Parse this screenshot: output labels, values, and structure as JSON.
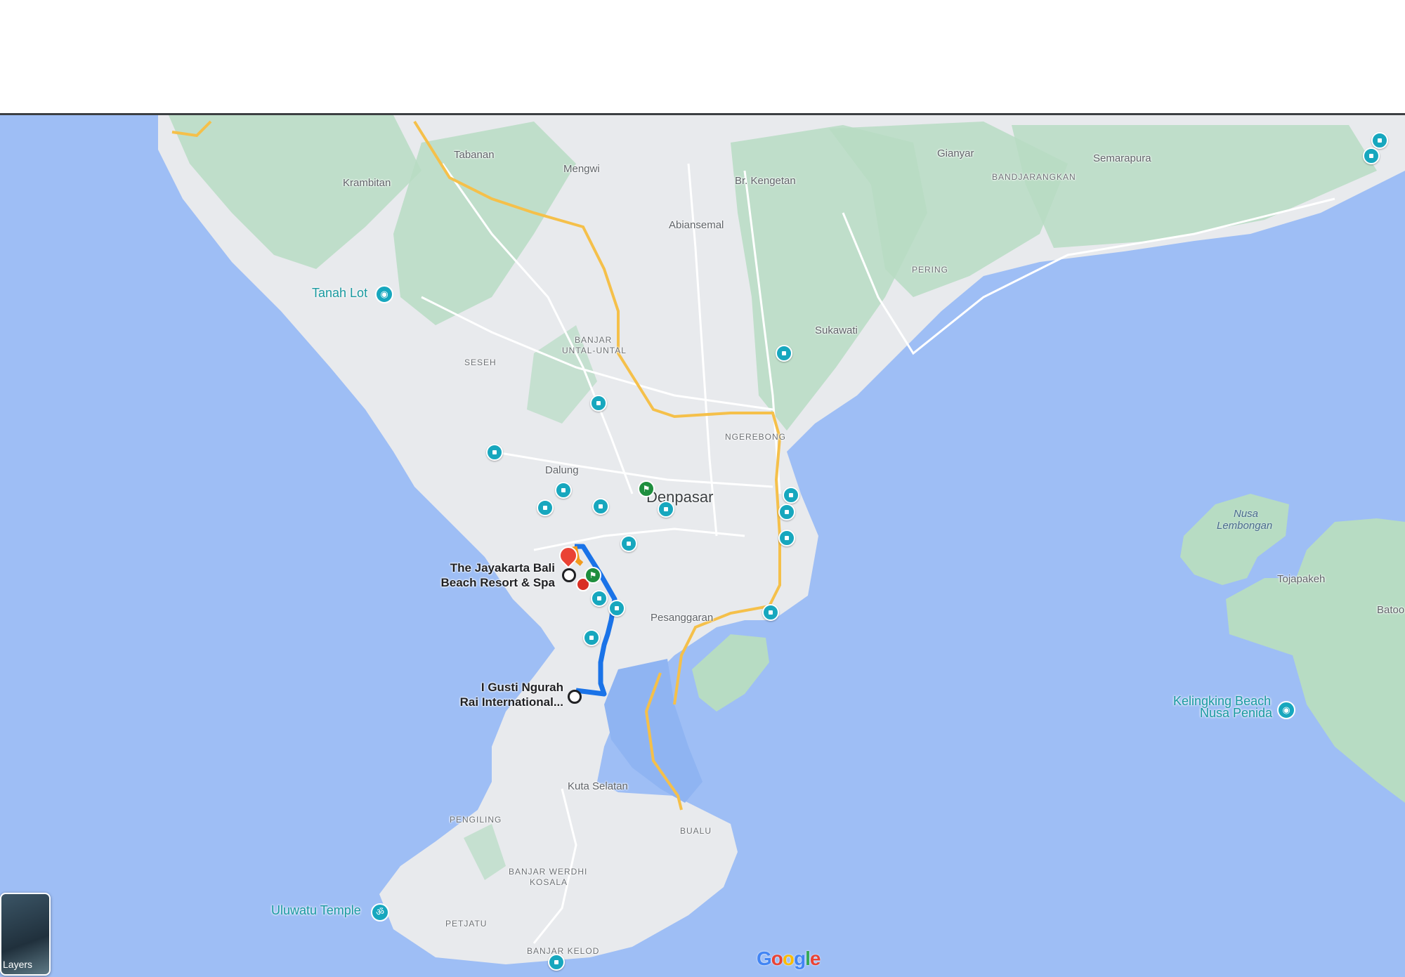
{
  "map": {
    "cities": {
      "denpasar": "Denpasar"
    },
    "towns": {
      "tabanan": "Tabanan",
      "mengwi": "Mengwi",
      "krambitan": "Krambitan",
      "br_kengetan": "Br. Kengetan",
      "abiansemal": "Abiansemal",
      "gianyar": "Gianyar",
      "semarapura": "Semarapura",
      "sukawati": "Sukawati",
      "dalung": "Dalung",
      "pesanggaran": "Pesanggaran",
      "kuta_selatan": "Kuta Selatan",
      "tojapakeh": "Tojapakeh",
      "batoo": "Batoo"
    },
    "districts": {
      "bandjarangkan": "BANDJARANGKAN",
      "pering": "PERING",
      "banjar_untal_untal_1": "BANJAR",
      "banjar_untal_untal_2": "UNTAL-UNTAL",
      "seseh": "SESEH",
      "ngerebong": "NGEREBONG",
      "bualu": "BUALU",
      "pengiling": "PENGILING",
      "banjar_werdhi_1": "BANJAR WERDHI",
      "banjar_werdhi_2": "KOSALA",
      "petjatu": "PETJATU",
      "banjar_kelod": "BANJAR KELOD"
    },
    "pois": {
      "tanah_lot": "Tanah Lot",
      "uluwatu": "Uluwatu Temple",
      "kelingking_1": "Kelingking Beach",
      "kelingking_2": "Nusa Penida"
    },
    "places": {
      "hotel_1": "The Jayakarta Bali",
      "hotel_2": "Beach Resort & Spa",
      "airport_1": "I Gusti Ngurah",
      "airport_2": "Rai International..."
    },
    "islands": {
      "lembongan_1": "Nusa",
      "lembongan_2": "Lembongan"
    },
    "controls": {
      "layers": "Layers"
    },
    "attribution": "Google",
    "colors": {
      "water": "#9ebef5",
      "land": "#e8eaed",
      "park": "#b7dcc3",
      "route": "#1a73e8",
      "highway": "#f5c04a",
      "pin": "#17a7be",
      "dest_pin": "#ea4335"
    }
  }
}
